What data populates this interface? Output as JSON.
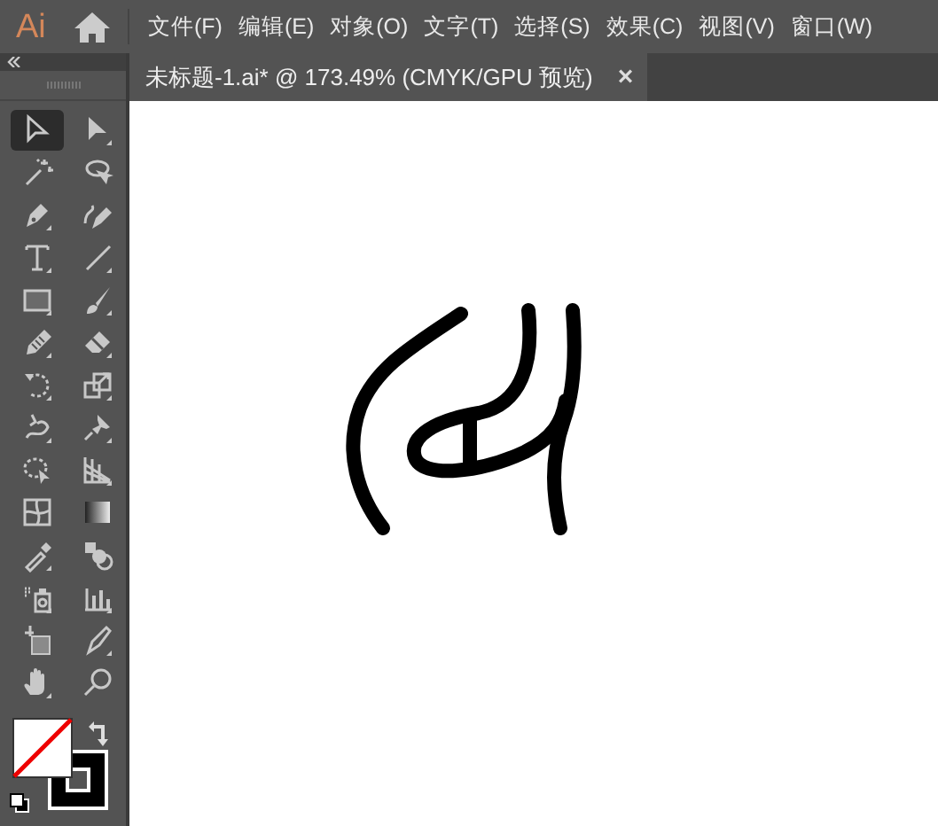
{
  "app": {
    "logo": "Ai"
  },
  "menu": [
    {
      "label": "文件(F)"
    },
    {
      "label": "编辑(E)"
    },
    {
      "label": "对象(O)"
    },
    {
      "label": "文字(T)"
    },
    {
      "label": "选择(S)"
    },
    {
      "label": "效果(C)"
    },
    {
      "label": "视图(V)"
    },
    {
      "label": "窗口(W)"
    }
  ],
  "document_tab": {
    "title": "未标题-1.ai* @ 173.49% (CMYK/GPU 预览)",
    "close": "×",
    "selected": true
  },
  "tools": [
    {
      "kind": "selection",
      "selected": true
    },
    {
      "kind": "direct",
      "selected": false
    },
    {
      "kind": "wand",
      "selected": false
    },
    {
      "kind": "lasso",
      "selected": false
    },
    {
      "kind": "pen",
      "selected": false
    },
    {
      "kind": "curvature",
      "selected": false
    },
    {
      "kind": "type",
      "selected": false
    },
    {
      "kind": "line",
      "selected": false
    },
    {
      "kind": "rect",
      "selected": false
    },
    {
      "kind": "brush",
      "selected": false
    },
    {
      "kind": "pencil",
      "selected": false
    },
    {
      "kind": "eraser",
      "selected": false
    },
    {
      "kind": "rotate",
      "selected": false
    },
    {
      "kind": "scale",
      "selected": false
    },
    {
      "kind": "warp",
      "selected": false
    },
    {
      "kind": "pin",
      "selected": false
    },
    {
      "kind": "transform",
      "selected": false
    },
    {
      "kind": "perspective",
      "selected": false
    },
    {
      "kind": "mesh",
      "selected": false
    },
    {
      "kind": "gradient",
      "selected": false
    },
    {
      "kind": "eyedropper",
      "selected": false
    },
    {
      "kind": "blend",
      "selected": false
    },
    {
      "kind": "spray",
      "selected": false
    },
    {
      "kind": "graph",
      "selected": false
    },
    {
      "kind": "artboard",
      "selected": false
    },
    {
      "kind": "slice",
      "selected": false
    },
    {
      "kind": "hand",
      "selected": false
    },
    {
      "kind": "zoom",
      "selected": false
    }
  ]
}
